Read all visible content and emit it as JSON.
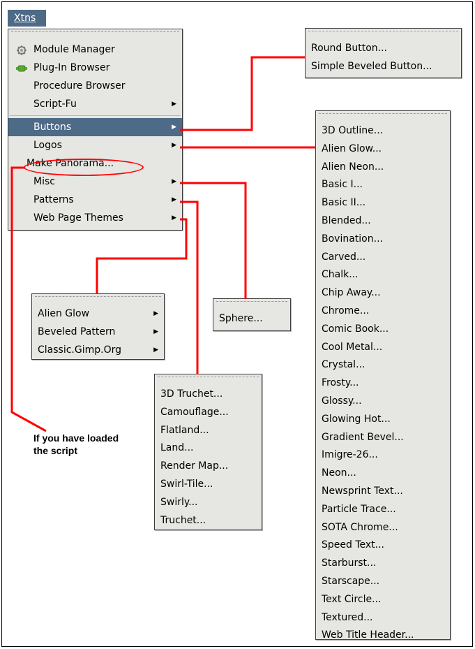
{
  "menubar": {
    "label": "Xtns"
  },
  "main_menu": {
    "items": [
      {
        "label": "Module Manager",
        "icon": "gear-icon",
        "submenu": false
      },
      {
        "label": "Plug-In Browser",
        "icon": "plugin-icon",
        "submenu": false
      },
      {
        "label": "Procedure Browser",
        "submenu": false
      },
      {
        "label": "Script-Fu",
        "submenu": true
      },
      {
        "label": "Buttons",
        "submenu": true,
        "selected": true
      },
      {
        "label": "Logos",
        "submenu": true
      },
      {
        "label": "Make Panorama...",
        "submenu": false
      },
      {
        "label": "Misc",
        "submenu": true
      },
      {
        "label": "Patterns",
        "submenu": true
      },
      {
        "label": "Web Page Themes",
        "submenu": true
      }
    ]
  },
  "buttons_menu": {
    "items": [
      "Round Button...",
      "Simple Beveled Button..."
    ]
  },
  "logos_menu": {
    "items": [
      "3D Outline...",
      "Alien Glow...",
      "Alien Neon...",
      "Basic I...",
      "Basic II...",
      "Blended...",
      "Bovination...",
      "Carved...",
      "Chalk...",
      "Chip Away...",
      "Chrome...",
      "Comic Book...",
      "Cool Metal...",
      "Crystal...",
      "Frosty...",
      "Glossy...",
      "Glowing Hot...",
      "Gradient Bevel...",
      "Imigre-26...",
      "Neon...",
      "Newsprint Text...",
      "Particle Trace...",
      "SOTA Chrome...",
      "Speed Text...",
      "Starburst...",
      "Starscape...",
      "Text Circle...",
      "Textured...",
      "Web Title Header..."
    ]
  },
  "web_themes_menu": {
    "items": [
      "Alien Glow",
      "Beveled Pattern",
      "Classic.Gimp.Org"
    ]
  },
  "misc_menu": {
    "items": [
      "Sphere..."
    ]
  },
  "patterns_menu": {
    "items": [
      "3D Truchet...",
      "Camouflage...",
      "Flatland...",
      "Land...",
      "Render Map...",
      "Swirl-Tile...",
      "Swirly...",
      "Truchet..."
    ]
  },
  "annotation": {
    "line1": "If you have loaded",
    "line2": "the script"
  },
  "colors": {
    "accent": "#4d6a87",
    "annotation": "#ff0000",
    "menu_bg": "#e6e6e3"
  }
}
